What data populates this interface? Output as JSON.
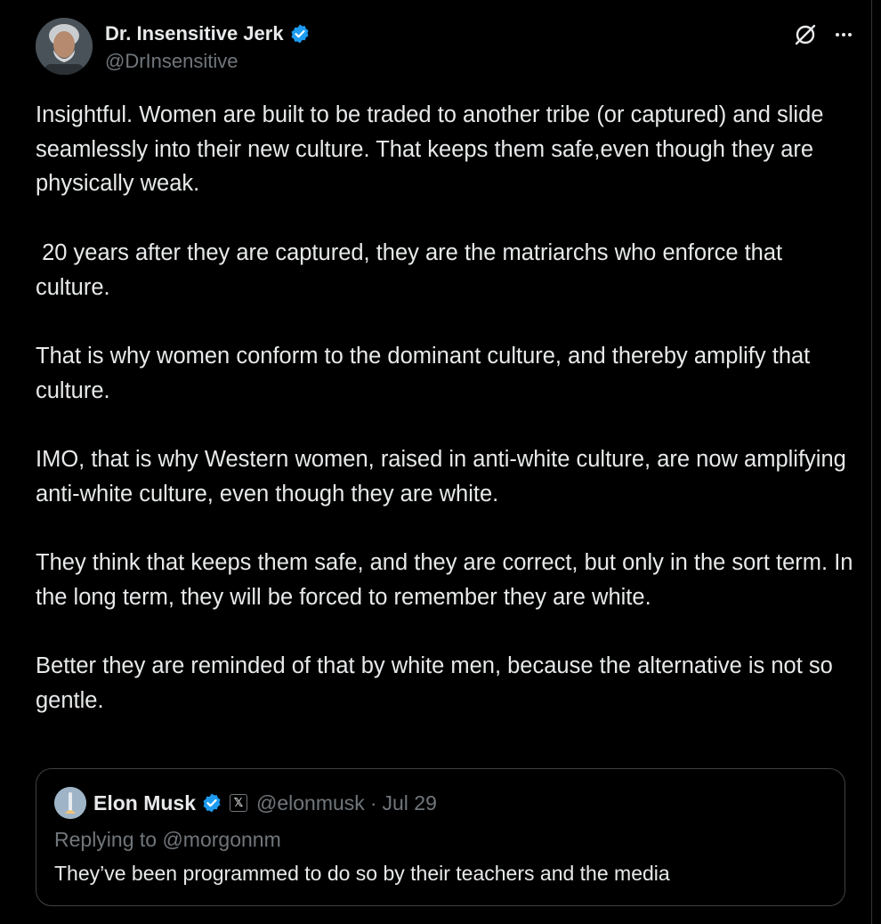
{
  "colors": {
    "background": "#000000",
    "text_primary": "#e7e9ea",
    "text_secondary": "#71767b",
    "verified_blue": "#1d9bf0",
    "border": "#3e4144"
  },
  "tweet": {
    "author": {
      "display_name": "Dr. Insensitive Jerk",
      "handle": "@DrInsensitive",
      "verified": true,
      "avatar_icon": "avatar-photo"
    },
    "actions": {
      "grok_icon": "grok-icon",
      "more_icon": "more-icon"
    },
    "paragraphs": [
      "Insightful. Women are built to be traded to another tribe (or captured) and slide seamlessly into their new culture. That keeps them safe,even though they are physically weak.",
      " 20 years after they are captured, they are the matriarchs who enforce that culture.",
      "That is why women conform to the dominant culture, and thereby amplify that culture.",
      "IMO, that is why Western women, raised in anti-white culture, are now amplifying anti-white culture, even though they are white.",
      "They think that keeps them safe, and they are correct, but only in the sort term. In the long term, they will be forced to remember they are white.",
      "Better they are reminded of that by white men, because the alternative is not so gentle."
    ]
  },
  "quoted_tweet": {
    "author": {
      "display_name": "Elon Musk",
      "handle": "@elonmusk",
      "verified": true,
      "affiliate_badge": "𝕏"
    },
    "separator": "·",
    "date": "Jul 29",
    "replying_to": "Replying to @morgonnm",
    "text": "They’ve been programmed to do so by their teachers and the media"
  }
}
